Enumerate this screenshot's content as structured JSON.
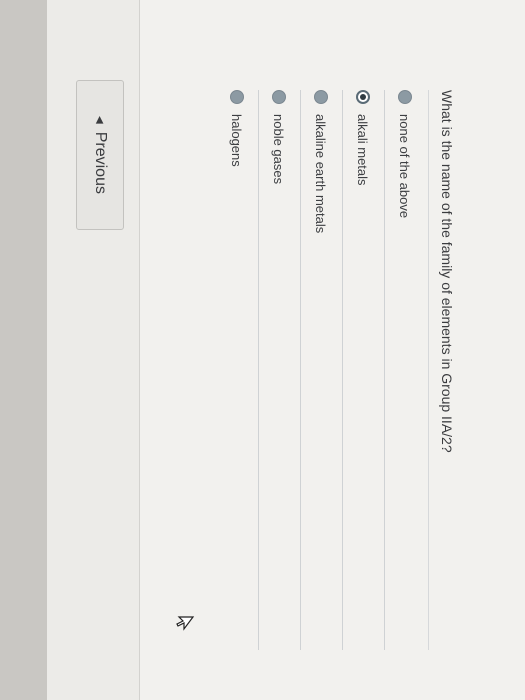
{
  "quiz": {
    "question": "What is the name of the family of elements in Group IIA/2?",
    "options": [
      {
        "label": "none of the above",
        "selected": false
      },
      {
        "label": "alkali metals",
        "selected": true
      },
      {
        "label": "alkaline earth metals",
        "selected": false
      },
      {
        "label": "noble gases",
        "selected": false
      },
      {
        "label": "halogens",
        "selected": false
      }
    ]
  },
  "navigation": {
    "previous_label": "Previous",
    "previous_icon": "triangle-left-icon"
  },
  "colors": {
    "radio_unselected": "#8c9aa3",
    "radio_selected_dot": "#2f3b42",
    "text": "#3b3c3f"
  }
}
